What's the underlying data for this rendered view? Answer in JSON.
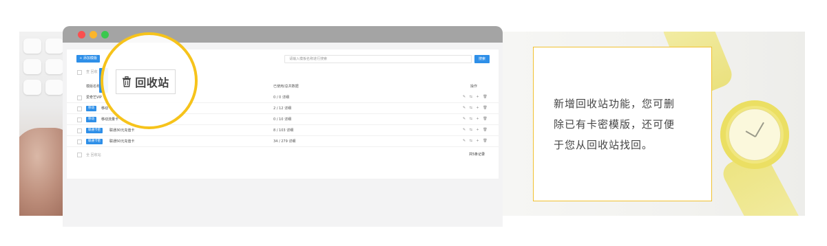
{
  "feature": {
    "text_line1": "新增回收站功能，您可删",
    "text_line2": "除已有卡密模版，还可便",
    "text_line3": "于您从回收站找回。"
  },
  "toolbar": {
    "add_label": "+ 添加模版",
    "search_placeholder": "请输入模板名称进行搜索",
    "search_label": "搜索"
  },
  "table": {
    "header_check_label": "查 回收",
    "col_name": "模版名称",
    "col_used": "已使用/总共数据",
    "col_ops": "操作",
    "ops_glyphs": "✎ ⇆ + 🗑",
    "rows": [
      {
        "tag": "",
        "name": "爱奇艺VIP",
        "used": "0 / 0 详细"
      },
      {
        "tag": "移动",
        "name": "移动",
        "used": "2 / 12 详细"
      },
      {
        "tag": "移动",
        "name": "移动流量卡",
        "used": "0 / 10 详细"
      },
      {
        "tag": "联通卡密",
        "name": "联通30元充值卡",
        "used": "8 / 103 详细"
      },
      {
        "tag": "联通卡密",
        "name": "联通50元充值卡",
        "used": "34 / 279 详细"
      }
    ],
    "footer_label": "全 回收站",
    "footer_total": "共5条记录"
  },
  "magnifier": {
    "label": "回收站",
    "icon": "trash-icon"
  },
  "colors": {
    "accent": "#2e8fe8",
    "highlight": "#f6c31b",
    "titlebar": "#a4a4a4"
  }
}
